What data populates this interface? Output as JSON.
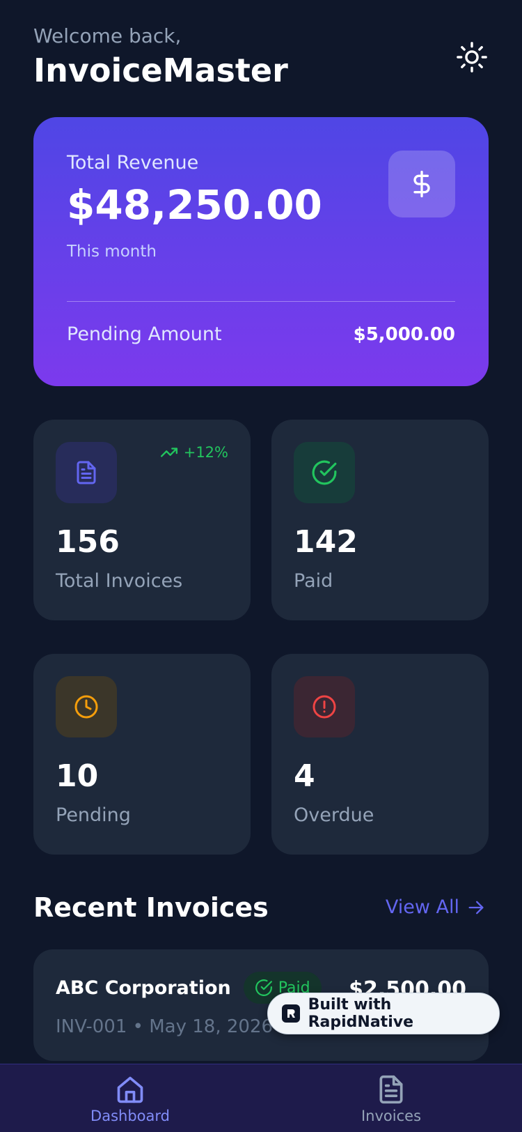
{
  "header": {
    "welcome": "Welcome back,",
    "title": "InvoiceMaster",
    "theme_icon": "sun-icon"
  },
  "revenue": {
    "label": "Total Revenue",
    "value": "$48,250.00",
    "period": "This month",
    "pending_label": "Pending Amount",
    "pending_value": "$5,000.00",
    "icon": "dollar-icon"
  },
  "stats": [
    {
      "value": "156",
      "label": "Total Invoices",
      "trend": "+12%",
      "icon": "document-icon",
      "color": "#6366f1"
    },
    {
      "value": "142",
      "label": "Paid",
      "icon": "check-circle-icon",
      "color": "#22c55e"
    },
    {
      "value": "10",
      "label": "Pending",
      "icon": "clock-icon",
      "color": "#f59e0b"
    },
    {
      "value": "4",
      "label": "Overdue",
      "icon": "alert-circle-icon",
      "color": "#ef4444"
    }
  ],
  "recent": {
    "title": "Recent Invoices",
    "view_all": "View All",
    "invoices": [
      {
        "company": "ABC Corporation",
        "status": "Paid",
        "amount": "$2,500.00",
        "meta": "INV-001 • May 18, 2026"
      }
    ]
  },
  "badge": {
    "text": "Built with RapidNative"
  },
  "tabs": [
    {
      "label": "Dashboard",
      "icon": "home-icon",
      "active": true
    },
    {
      "label": "Invoices",
      "icon": "document-icon",
      "active": false
    }
  ],
  "colors": {
    "background": "#0f172a",
    "card": "#1e293b",
    "accent": "#6366f1",
    "gradient_start": "#4f46e5",
    "gradient_end": "#7c3aed"
  }
}
